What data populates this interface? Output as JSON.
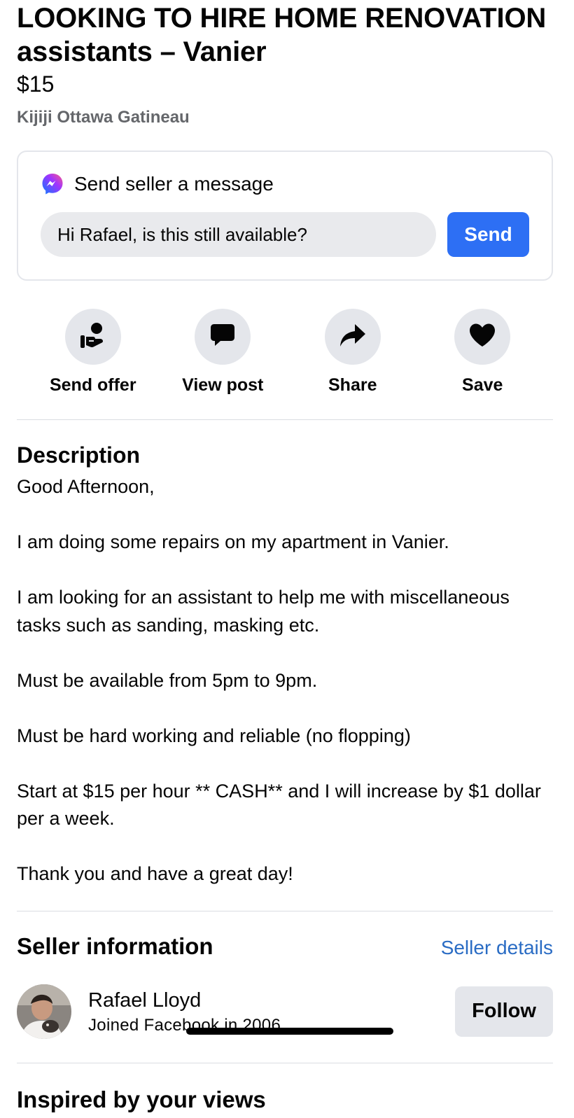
{
  "listing": {
    "title": "LOOKING TO HIRE HOME RENOVATION assistants – Vanier",
    "price": "$15",
    "location": "Kijiji Ottawa Gatineau"
  },
  "message": {
    "header": "Send seller a message",
    "input_value": "Hi Rafael, is this still available?",
    "send_label": "Send",
    "icon": "messenger-icon"
  },
  "actions": [
    {
      "label": "Send offer",
      "icon": "hand-offer-icon"
    },
    {
      "label": "View post",
      "icon": "chat-bubble-icon"
    },
    {
      "label": "Share",
      "icon": "share-arrow-icon"
    },
    {
      "label": "Save",
      "icon": "heart-icon"
    }
  ],
  "description": {
    "title": "Description",
    "paragraphs": [
      "Good Afternoon,",
      "I am doing some repairs on my apartment in Vanier.",
      "I am looking for an assistant to help me with miscellaneous tasks such as sanding, masking etc.",
      "Must be available from 5pm to 9pm.",
      "Must be hard working and reliable (no flopping)",
      "Start at  $15 per hour ** CASH** and I will increase by $1 dollar per a week.",
      "Thank you and have a great day!"
    ]
  },
  "seller": {
    "section_title": "Seller information",
    "details_link": "Seller details",
    "name": "Rafael Lloyd",
    "joined": "Joined Facebook in 2006",
    "follow_label": "Follow"
  },
  "inspired": {
    "title": "Inspired by your views"
  },
  "colors": {
    "primary": "#2d6ff4",
    "link": "#2a6cc4",
    "secondary_text": "#65676b",
    "button_gray": "#e4e6eb"
  }
}
